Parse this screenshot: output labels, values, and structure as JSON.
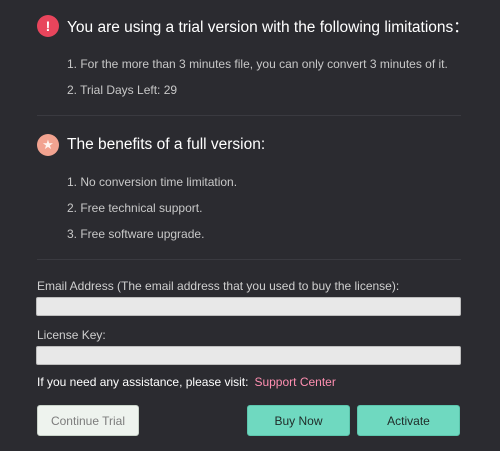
{
  "limitations": {
    "icon": "exclamation-icon",
    "title": "You are using a trial version with the following limitations：",
    "items": [
      "1. For the more than 3 minutes file, you can only convert 3 minutes of it.",
      "2. Trial Days Left: 29"
    ]
  },
  "benefits": {
    "icon": "star-icon",
    "title": "The benefits of a full version:",
    "items": [
      "1. No conversion time limitation.",
      "2. Free technical support.",
      "3. Free software upgrade."
    ]
  },
  "form": {
    "email_label": "Email Address (The email address that you used to buy the license):",
    "email_value": "",
    "license_label": "License Key:",
    "license_value": ""
  },
  "assistance": {
    "text": "If you need any assistance, please visit:",
    "link": "Support Center"
  },
  "buttons": {
    "continue_trial": "Continue Trial",
    "buy_now": "Buy Now",
    "activate": "Activate"
  },
  "colors": {
    "background": "#2b2b30",
    "accent": "#6fd9c0",
    "link": "#ff8fb1",
    "alert": "#e8455c",
    "star": "#f2a390"
  }
}
